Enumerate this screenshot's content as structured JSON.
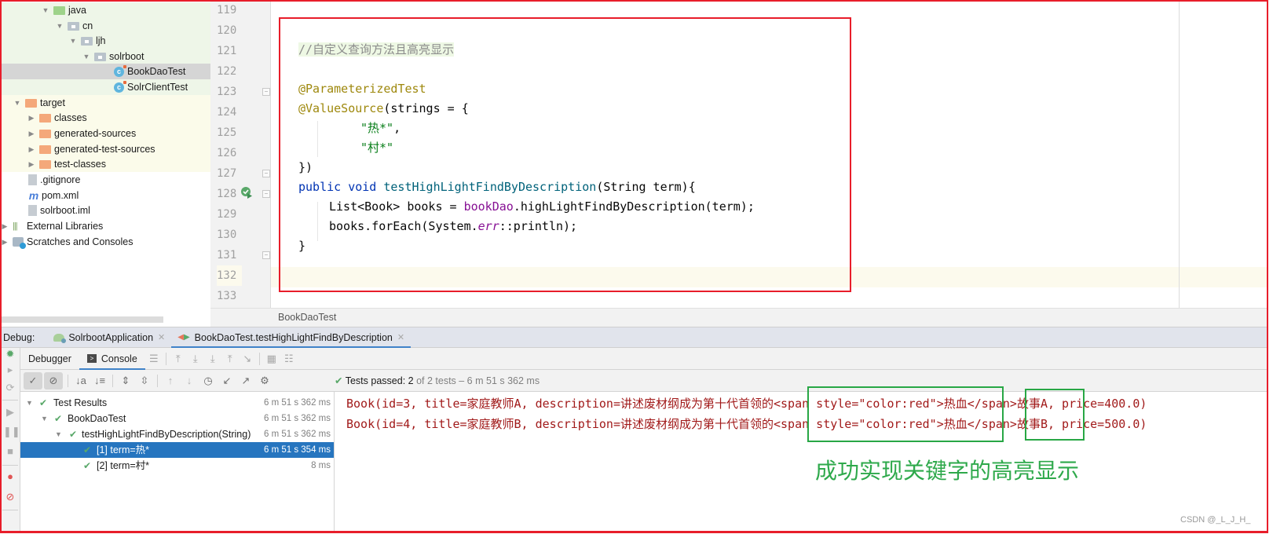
{
  "project_tree": {
    "items": [
      {
        "label": "java",
        "kind": "source-folder",
        "expanded": true
      },
      {
        "label": "cn",
        "kind": "package",
        "expanded": true
      },
      {
        "label": "ljh",
        "kind": "package",
        "expanded": true
      },
      {
        "label": "solrboot",
        "kind": "package",
        "expanded": true
      },
      {
        "label": "BookDaoTest",
        "kind": "test-class",
        "selected": true
      },
      {
        "label": "SolrClientTest",
        "kind": "test-class"
      },
      {
        "label": "target",
        "kind": "excluded-folder",
        "expanded": true
      },
      {
        "label": "classes",
        "kind": "excluded-folder",
        "expanded": false
      },
      {
        "label": "generated-sources",
        "kind": "excluded-folder",
        "expanded": false
      },
      {
        "label": "generated-test-sources",
        "kind": "excluded-folder",
        "expanded": false
      },
      {
        "label": "test-classes",
        "kind": "excluded-folder",
        "expanded": false
      },
      {
        "label": ".gitignore",
        "kind": "file-ignored"
      },
      {
        "label": "pom.xml",
        "kind": "maven-file"
      },
      {
        "label": "solrboot.iml",
        "kind": "module-file"
      },
      {
        "label": "External Libraries",
        "kind": "libraries",
        "expanded": false
      },
      {
        "label": "Scratches and Consoles",
        "kind": "scratches",
        "expanded": false
      }
    ]
  },
  "editor": {
    "line_numbers": [
      "119",
      "120",
      "121",
      "122",
      "123",
      "124",
      "125",
      "126",
      "127",
      "128",
      "129",
      "130",
      "131",
      "132",
      "133"
    ],
    "code": {
      "comment": "//自定义查询方法且高亮显示",
      "anno1": "@ParameterizedTest",
      "anno2": "@ValueSource",
      "anno2_rest": "(strings = {",
      "str1": "\"热*\"",
      "str1_rest": ",",
      "str2": "\"村*\"",
      "close_anno": "})",
      "kw_public": "public",
      "kw_void": "void",
      "method_name": "testHighLightFindByDescription",
      "method_params": "(String term){",
      "l129_a": "List<Book> books = ",
      "l129_field": "bookDao",
      "l129_b": ".highLightFindByDescription(term);",
      "l130_a": "books.forEach(System.",
      "l130_static": "err",
      "l130_b": "::println);",
      "l131": "}"
    },
    "breadcrumb": "BookDaoTest"
  },
  "debug": {
    "label": "Debug:",
    "tabs": [
      {
        "label": "SolrbootApplication",
        "active": false
      },
      {
        "label": "BookDaoTest.testHighLightFindByDescription",
        "active": true
      }
    ],
    "subtabs": [
      {
        "label": "Debugger",
        "active": false
      },
      {
        "label": "Console",
        "active": true
      }
    ],
    "tests_status": {
      "prefix": "Tests passed: ",
      "passed": "2",
      "rest": " of 2 tests – 6 m 51 s 362 ms"
    },
    "test_tree": [
      {
        "label": "Test Results",
        "time": "6 m 51 s 362 ms",
        "level": 0
      },
      {
        "label": "BookDaoTest",
        "time": "6 m 51 s 362 ms",
        "level": 1
      },
      {
        "label": "testHighLightFindByDescription(String)",
        "time": "6 m 51 s 362 ms",
        "level": 2
      },
      {
        "label": "[1] term=热*",
        "time": "6 m 51 s 354 ms",
        "level": 3,
        "selected": true
      },
      {
        "label": "[2] term=村*",
        "time": "8 ms",
        "level": 3
      }
    ],
    "console_lines": [
      "Book(id=3, title=家庭教师A, description=讲述废材纲成为第十代首领的<span style=\"color:red\">热血</span>故事A, price=400.0)",
      "Book(id=4, title=家庭教师B, description=讲述废材纲成为第十代首领的<span style=\"color:red\">热血</span>故事B, price=500.0)"
    ]
  },
  "annotation": {
    "caption": "成功实现关键字的高亮显示",
    "watermark": "CSDN @_L_J_H_"
  },
  "colors": {
    "annotation_red": "#e81d2a",
    "annotation_green": "#28a745",
    "selection_blue": "#2675bf",
    "console_text": "#a11a1a",
    "pass_green": "#59a869"
  }
}
